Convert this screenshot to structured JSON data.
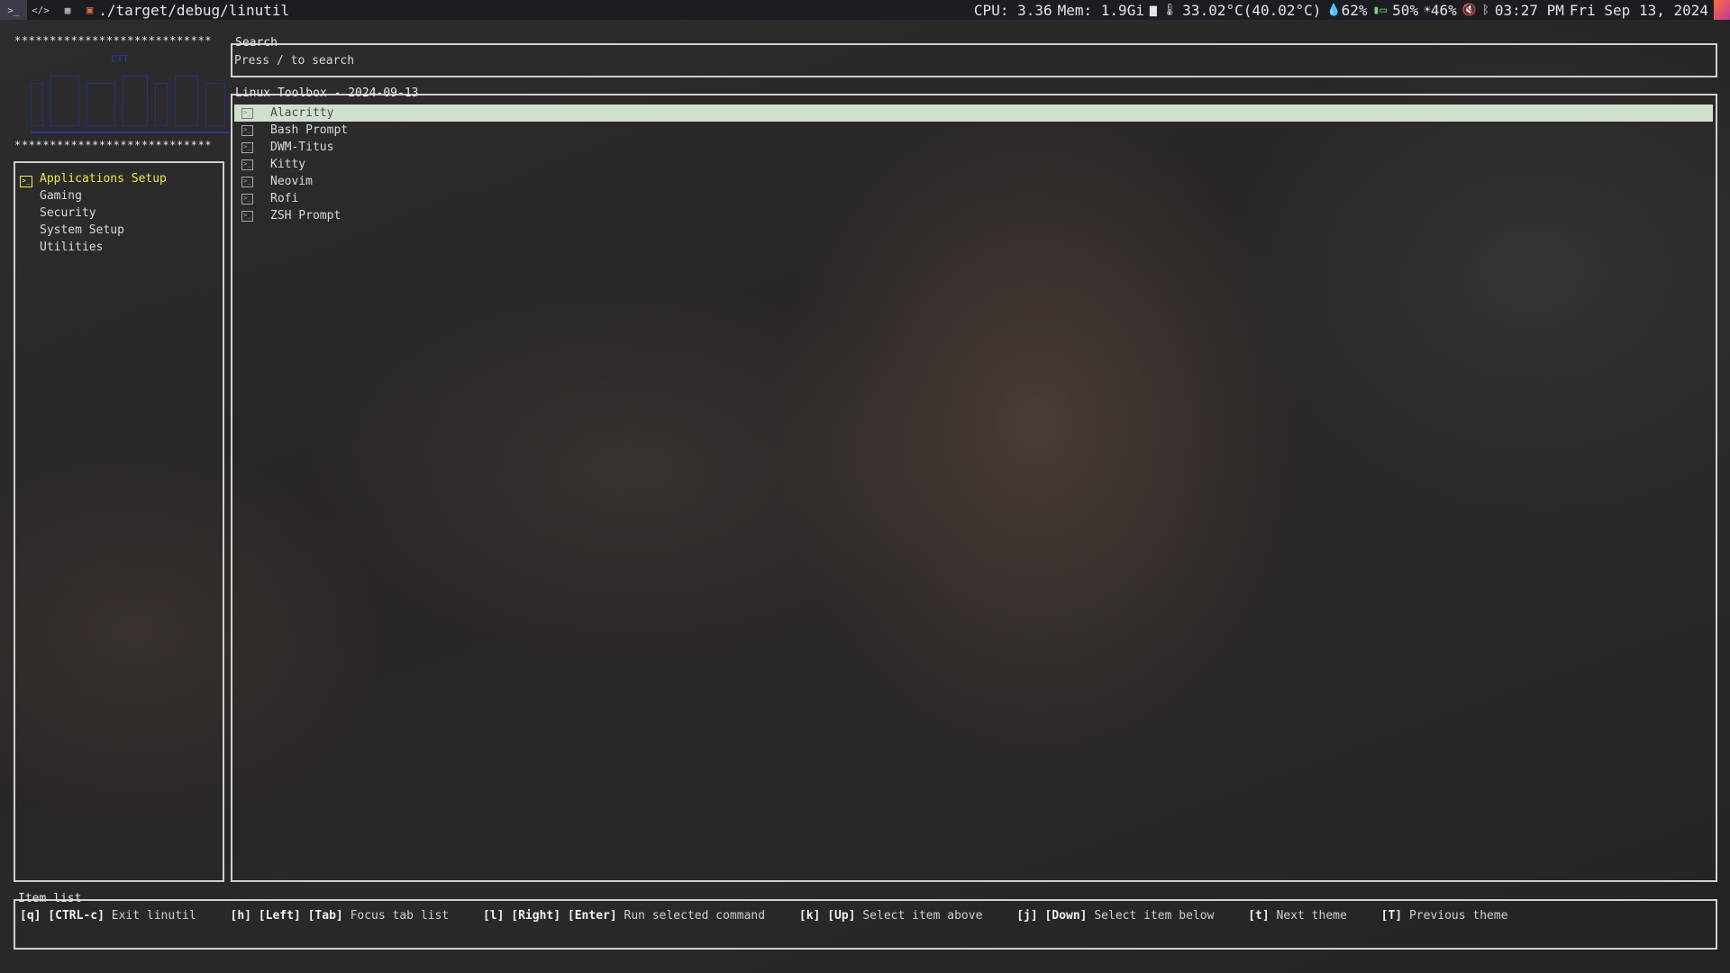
{
  "topbar": {
    "workspace_icons": [
      "terminal-icon",
      "code-icon",
      "grid-icon"
    ],
    "window_title": "./target/debug/linutil",
    "cpu": "CPU: 3.36",
    "mem": "Mem: 1.9Gi",
    "temp": "33.02°C(40.02°C)",
    "humidity": "62%",
    "battery": "50%",
    "brightness": "46%",
    "time": "03:27 PM",
    "date": "Fri Sep 13, 2024"
  },
  "logo": {
    "stars": "****************************",
    "ctt": "CTT"
  },
  "search": {
    "title": "Search",
    "placeholder": "Press / to search"
  },
  "sidebar": {
    "items": [
      {
        "label": "Applications Setup",
        "selected": true
      },
      {
        "label": "Gaming"
      },
      {
        "label": "Security"
      },
      {
        "label": "System Setup"
      },
      {
        "label": "Utilities"
      }
    ]
  },
  "list": {
    "title": "Linux Toolbox - 2024-09-13",
    "items": [
      {
        "label": "Alacritty",
        "selected": true
      },
      {
        "label": "Bash Prompt"
      },
      {
        "label": "DWM-Titus"
      },
      {
        "label": "Kitty"
      },
      {
        "label": "Neovim"
      },
      {
        "label": "Rofi"
      },
      {
        "label": "ZSH Prompt"
      }
    ]
  },
  "footer": {
    "title": "Item list",
    "hints": [
      {
        "keys": "[q] [CTRL-c]",
        "action": "Exit linutil"
      },
      {
        "keys": "[h] [Left] [Tab]",
        "action": "Focus tab list"
      },
      {
        "keys": "[l] [Right] [Enter]",
        "action": "Run selected command"
      },
      {
        "keys": "[k] [Up]",
        "action": "Select item above"
      },
      {
        "keys": "[j] [Down]",
        "action": "Select item below"
      },
      {
        "keys": "[t]",
        "action": "Next theme"
      },
      {
        "keys": "[T]",
        "action": "Previous theme"
      }
    ]
  }
}
